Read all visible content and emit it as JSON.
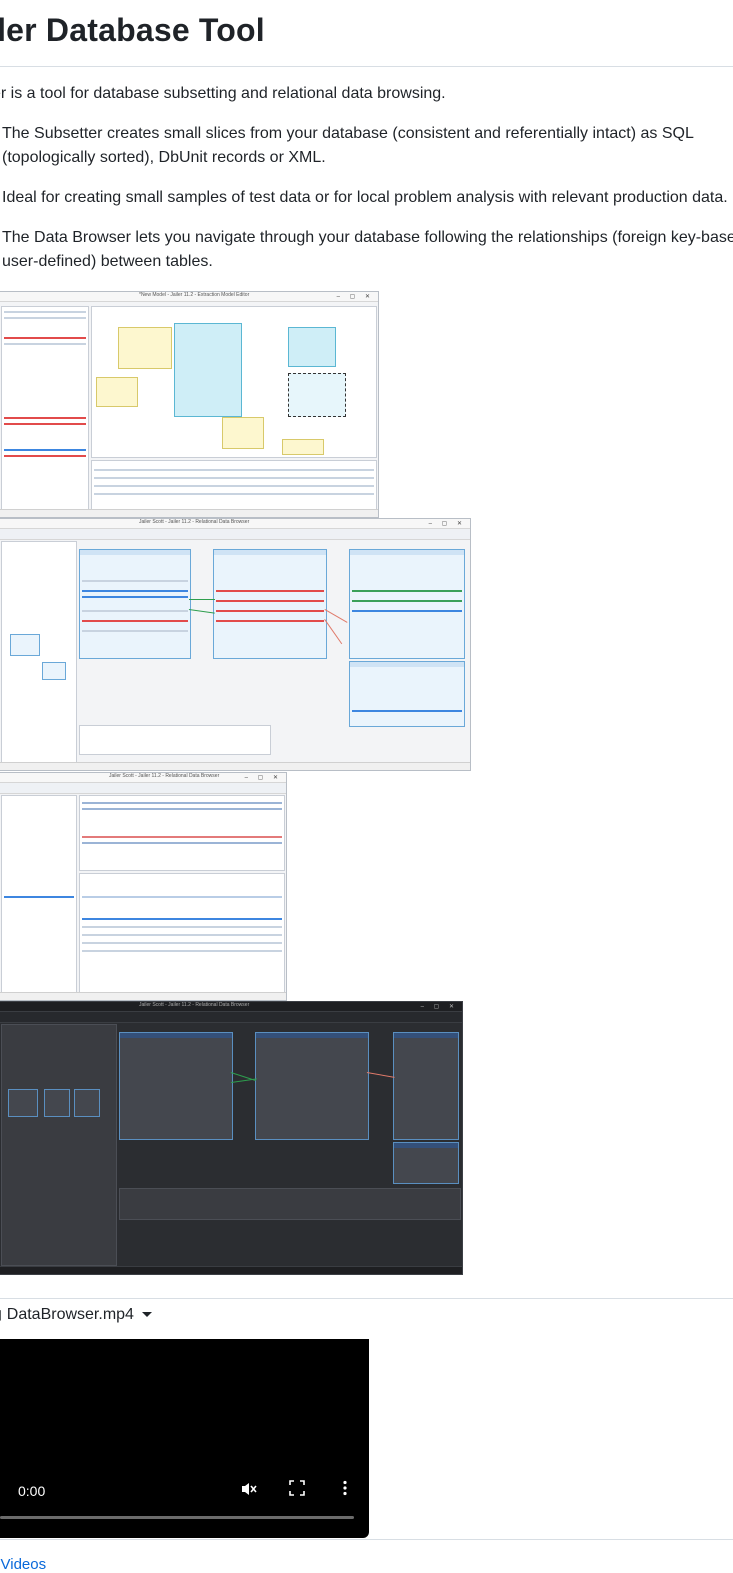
{
  "page": {
    "title": "ailer Database Tool",
    "intro": "er is a tool for database subsetting and relational data browsing.",
    "bullets": [
      {
        "line1": "The Subsetter creates small slices from your database (consistent and referentially intact) as SQL",
        "line2": "(topologically sorted), DbUnit records or XML."
      },
      {
        "line1": "Ideal for creating small samples of test data or for local problem analysis with relevant production data.",
        "line2": ""
      },
      {
        "line1": "The Data Browser lets you navigate through your database following the relationships (foreign key-base",
        "line2": "user-defined) between tables."
      }
    ]
  },
  "screenshots": [
    {
      "window_title": "*New Model - Jailer 11.2 - Extraction Model Editor",
      "theme": "light"
    },
    {
      "window_title": "Jailer Scott - Jailer 11.2 - Relational Data Browser",
      "theme": "light"
    },
    {
      "window_title": "Jailer Scott - Jailer 11.2 - Relational Data Browser",
      "theme": "light"
    },
    {
      "window_title": "Jailer Scott - Jailer 11.2 - Relational Data Browser",
      "theme": "dark"
    }
  ],
  "video": {
    "file_name": "DataBrowser.mp4",
    "current_time": "0:00",
    "progress": 0
  },
  "footer_link": "e Videos",
  "icons": {
    "video_file": "video-file-icon",
    "caret": "caret-down-icon",
    "mute": "muted-speaker-icon",
    "fullscreen": "fullscreen-icon",
    "more": "more-vertical-icon"
  },
  "colors": {
    "link": "#0969da",
    "text": "#1f2328",
    "rule": "#d8dee4",
    "video_bg": "#000000"
  }
}
